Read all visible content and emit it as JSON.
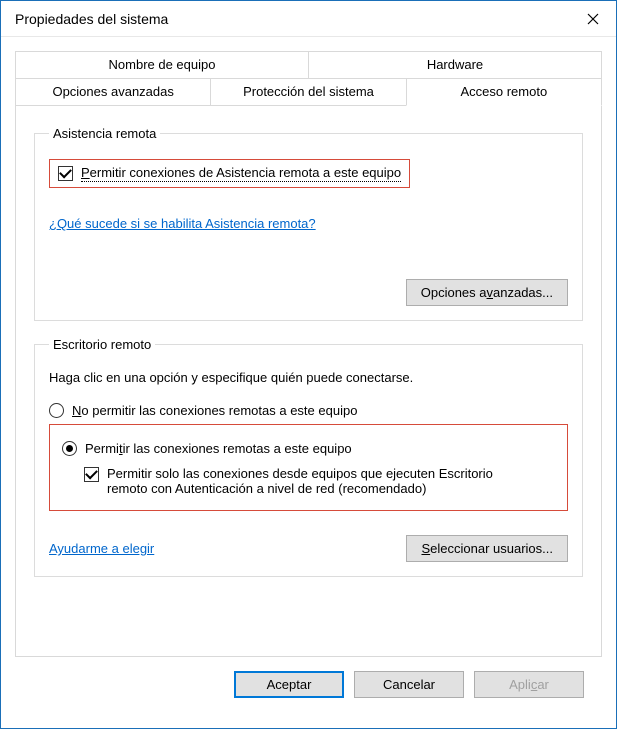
{
  "window": {
    "title": "Propiedades del sistema"
  },
  "tabs": {
    "row1": [
      "Nombre de equipo",
      "Hardware"
    ],
    "row2": [
      "Opciones avanzadas",
      "Protección del sistema",
      "Acceso remoto"
    ],
    "active": "Acceso remoto"
  },
  "remote_assistance": {
    "legend": "Asistencia remota",
    "checkbox_label": "Permitir conexiones de Asistencia remota a este equipo",
    "checkbox_checked": true,
    "help_link": "¿Qué sucede si se habilita Asistencia remota?",
    "advanced_button": "Opciones avanzadas..."
  },
  "remote_desktop": {
    "legend": "Escritorio remoto",
    "description": "Haga clic en una opción y especifique quién puede conectarse.",
    "radio_deny": "No permitir las conexiones remotas a este equipo",
    "radio_allow": "Permitir las conexiones remotas a este equipo",
    "selected": "allow",
    "nla_checkbox": "Permitir solo las conexiones desde equipos que ejecuten Escritorio remoto con Autenticación a nivel de red (recomendado)",
    "nla_checked": true,
    "help_link": "Ayudarme a elegir",
    "select_users_button": "Seleccionar usuarios..."
  },
  "buttons": {
    "ok": "Aceptar",
    "cancel": "Cancelar",
    "apply": "Aplicar"
  }
}
